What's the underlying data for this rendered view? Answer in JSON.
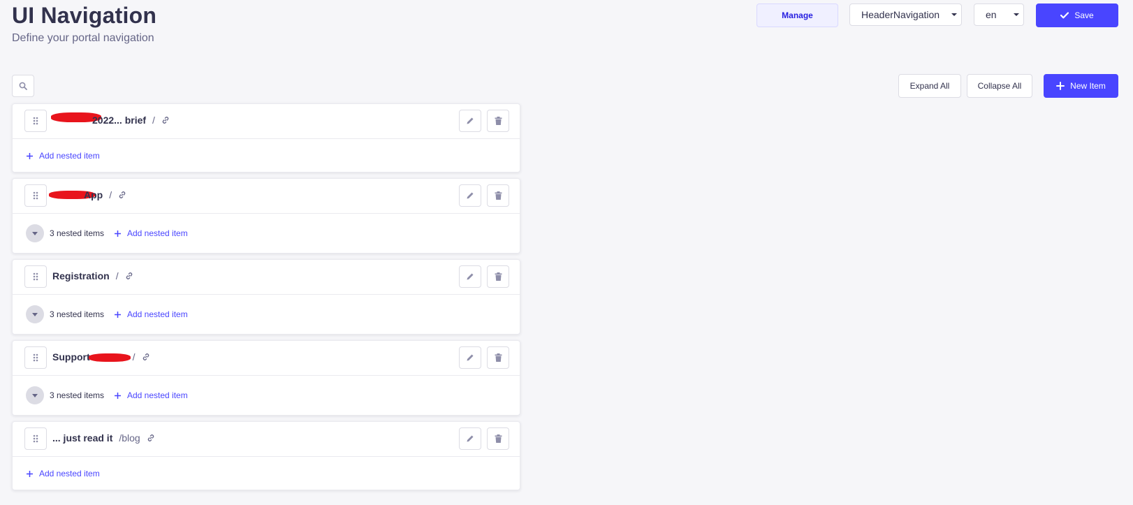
{
  "header": {
    "title": "UI Navigation",
    "subtitle": "Define your portal navigation",
    "manage_label": "Manage",
    "navigation_select": "HeaderNavigation",
    "locale_select": "en",
    "save_label": "Save"
  },
  "toolbar": {
    "search_icon": "search-icon",
    "expand_all_label": "Expand All",
    "collapse_all_label": "Collapse All",
    "new_item_label": "New Item"
  },
  "items": [
    {
      "title": "2022... brief",
      "path": "/",
      "nested_count": "",
      "add_nested_label": "Add nested item",
      "redacted": true
    },
    {
      "title": "App",
      "path": "/",
      "nested_count": "3 nested items",
      "add_nested_label": "Add nested item",
      "redacted": true
    },
    {
      "title": "Registration",
      "path": "/",
      "nested_count": "3 nested items",
      "add_nested_label": "Add nested item",
      "redacted": false
    },
    {
      "title": "Support",
      "path": "/",
      "nested_count": "3 nested items",
      "add_nested_label": "Add nested item",
      "redacted": true
    },
    {
      "title": "... just read it",
      "path": "/blog",
      "nested_count": "",
      "add_nested_label": "Add nested item",
      "redacted": false
    }
  ],
  "colors": {
    "primary": "#4945ff",
    "background": "#f6f6f9",
    "text": "#32324d",
    "redaction": "#e8141c"
  }
}
